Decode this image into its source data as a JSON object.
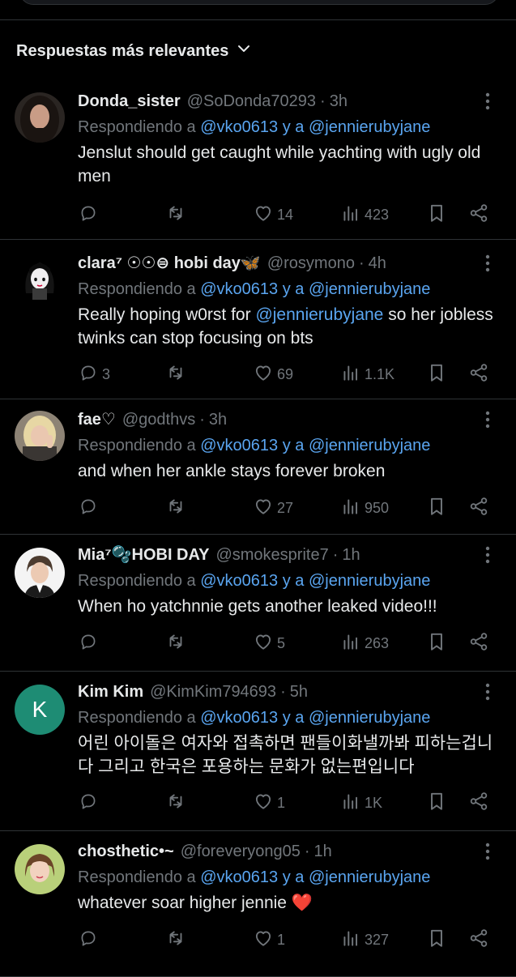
{
  "sort": {
    "label": "Respuestas más relevantes"
  },
  "replying_prefix": "Respondiendo a",
  "replying_mention_1": "@vko0613",
  "replying_join": "y a",
  "replying_mention_2": "@jennierubyjane",
  "replies": [
    {
      "name": "Donda_sister",
      "handle": "@SoDonda70293",
      "time": "3h",
      "text": "Jenslut should get caught while yachting with ugly old men",
      "reply_count": "",
      "like_count": "14",
      "view_count": "423",
      "avatar": "profile-photo-dark-hair"
    },
    {
      "name": "clara⁷ ☉☉⊜ hobi day🦋",
      "handle": "@rosymono",
      "time": "4h",
      "text_before": "Really hoping w0rst for ",
      "text_mention": "@jennierubyjane",
      "text_after": " so her jobless twinks can stop focusing on bts",
      "reply_count": "3",
      "like_count": "69",
      "view_count": "1.1K",
      "avatar": "cartoon-girl-avatar"
    },
    {
      "name": "fae♡",
      "handle": "@godthvs",
      "time": "3h",
      "text": "and when her ankle stays forever broken",
      "reply_count": "",
      "like_count": "27",
      "view_count": "950",
      "avatar": "profile-photo-blonde"
    },
    {
      "name": "Mia⁷🫧HOBI DAY",
      "handle": "@smokesprite7",
      "time": "1h",
      "text": "When ho yatchnnie gets another leaked video!!!",
      "reply_count": "",
      "like_count": "5",
      "view_count": "263",
      "avatar": "profile-photo-suit"
    },
    {
      "name": "Kim Kim",
      "handle": "@KimKim794693",
      "time": "5h",
      "text": "어린 아이돌은 여자와 접촉하면 팬들이화낼까봐 피하는겁니다 그리고 한국은 포용하는 문화가 없는편입니다",
      "reply_count": "",
      "like_count": "1",
      "view_count": "1K",
      "avatar_letter": "K",
      "avatar_color": "#1e8c74"
    },
    {
      "name": "chosthetic•~",
      "handle": "@foreveryong05",
      "time": "1h",
      "text": "whatever soar higher jennie",
      "text_emoji": "❤️",
      "reply_count": "",
      "like_count": "1",
      "view_count": "327",
      "avatar": "profile-photo-green-bg"
    }
  ],
  "colors": {
    "background": "#000000",
    "divider": "#2f3336",
    "text_primary": "#e7e9ea",
    "text_secondary": "#71767b",
    "link": "#5aa5f0"
  }
}
